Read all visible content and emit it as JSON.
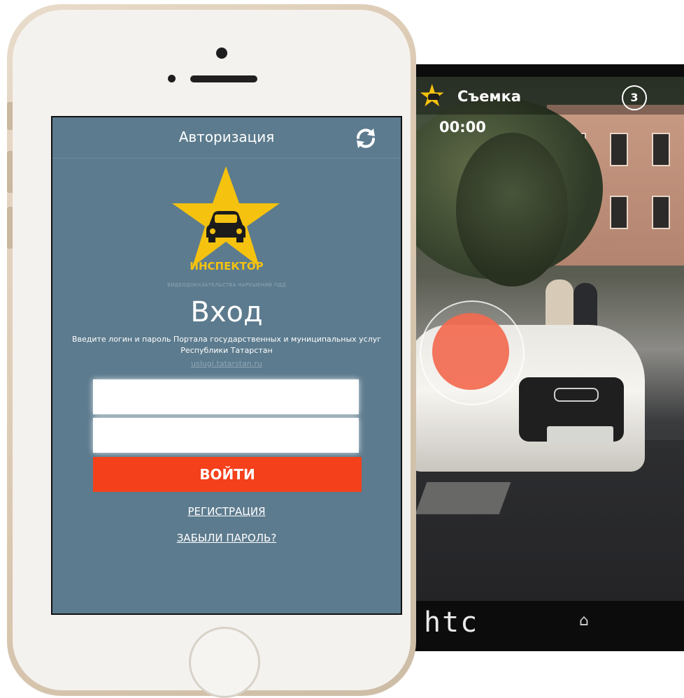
{
  "front_app": {
    "header_title": "Авторизация",
    "brand_name": "ИНСПЕКТОР",
    "brand_tagline": "ВИДЕОДОКАЗАТЕЛЬСТВА НАРУШЕНИЙ ПДД",
    "login_title": "Вход",
    "description": "Введите логин и пароль Портала государственных и муниципальных услуг Республики Татарстан",
    "portal_link": "uslugi.tatarstan.ru",
    "login_value": "",
    "password_value": "",
    "login_button": "ВОЙТИ",
    "register_link": "РЕГИСТРАЦИЯ",
    "forgot_link": "ЗАБЫЛИ ПАРОЛЬ?",
    "icons": [
      "refresh-icon",
      "star-car-logo"
    ],
    "colors": {
      "background": "#5c7b8e",
      "accent": "#f4401b",
      "brand": "#f5c20f"
    }
  },
  "back_app": {
    "title": "Съемка",
    "shot_count": "3",
    "timer": "00:00",
    "device_brand": "htc",
    "home_glyph": "⌂",
    "colors": {
      "record": "#f26a50"
    }
  }
}
